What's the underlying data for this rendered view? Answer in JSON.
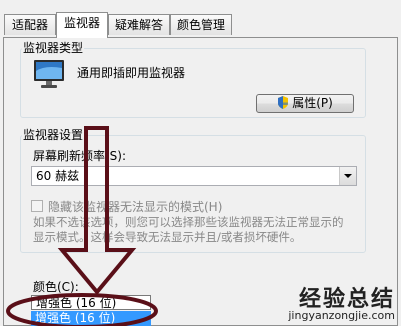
{
  "tabs": [
    {
      "label": "适配器"
    },
    {
      "label": "监视器"
    },
    {
      "label": "疑难解答"
    },
    {
      "label": "颜色管理"
    }
  ],
  "monitor_type": {
    "legend": "监视器类型",
    "monitor_name": "通用即插即用监视器",
    "properties_button": "属性(P)"
  },
  "monitor_settings": {
    "legend": "监视器设置",
    "refresh_label": "屏幕刷新频率(S):",
    "refresh_value": "60 赫兹",
    "hide_modes_label": "隐藏该监视器无法显示的模式(H)",
    "hint_line1": "如果不选该选项，则您可以选择那些该监视器无法正常显示的",
    "hint_line2": "显示模式。这样会导致无法显示并且/或者损坏硬件。"
  },
  "colors": {
    "label": "颜色(C):",
    "options": [
      "增强色 (16 位)",
      "增强色 (16 位)"
    ]
  },
  "watermark": {
    "text": "经验总结",
    "url": "jingyanzongjie.com"
  },
  "colors_theme": {
    "selection_blue": "#3399ff",
    "annotation_dark_red": "#5a0f18"
  }
}
